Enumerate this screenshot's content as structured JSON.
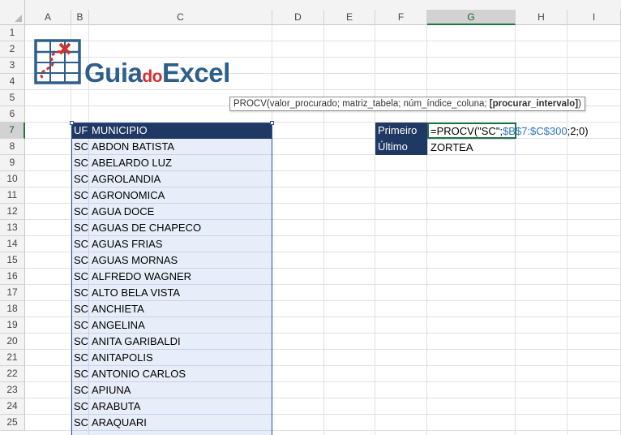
{
  "columns": [
    "A",
    "B",
    "C",
    "D",
    "E",
    "F",
    "G",
    "H",
    "I"
  ],
  "rows": [
    "1",
    "2",
    "3",
    "4",
    "5",
    "6",
    "7",
    "8",
    "9",
    "10",
    "11",
    "12",
    "13",
    "14",
    "15",
    "16",
    "17",
    "18",
    "19",
    "20",
    "21",
    "22",
    "23",
    "24",
    "25"
  ],
  "active_column": "G",
  "active_row": "7",
  "logo": {
    "part1": "Guia",
    "part2": "do",
    "part3": "Excel",
    "icon": "grid-with-red-x-logo-icon"
  },
  "tooltip": {
    "func": "PROCV(",
    "args": "valor_procurado; matriz_tabela; núm_índice_coluna; ",
    "opt": "[procurar_intervalo]",
    "close": ")"
  },
  "table": {
    "header": [
      "UF",
      "MUNICIPIO"
    ],
    "rows": [
      [
        "SC",
        "ABDON BATISTA"
      ],
      [
        "SC",
        "ABELARDO LUZ"
      ],
      [
        "SC",
        "AGROLANDIA"
      ],
      [
        "SC",
        "AGRONOMICA"
      ],
      [
        "SC",
        "AGUA DOCE"
      ],
      [
        "SC",
        "AGUAS DE CHAPECO"
      ],
      [
        "SC",
        "AGUAS FRIAS"
      ],
      [
        "SC",
        "AGUAS MORNAS"
      ],
      [
        "SC",
        "ALFREDO WAGNER"
      ],
      [
        "SC",
        "ALTO BELA VISTA"
      ],
      [
        "SC",
        "ANCHIETA"
      ],
      [
        "SC",
        "ANGELINA"
      ],
      [
        "SC",
        "ANITA GARIBALDI"
      ],
      [
        "SC",
        "ANITAPOLIS"
      ],
      [
        "SC",
        "ANTONIO CARLOS"
      ],
      [
        "SC",
        "APIUNA"
      ],
      [
        "SC",
        "ARABUTA"
      ],
      [
        "SC",
        "ARAQUARI"
      ]
    ]
  },
  "lookup": {
    "label1": "Primeiro",
    "formula_start": "=PROCV(\"SC\";",
    "formula_range": "$B$7:$C$300",
    "formula_end": ";2;0)",
    "label2": "Último",
    "value2": "ZORTEA"
  },
  "colors": {
    "header": "#203864",
    "table_fill": "#e8eef9",
    "range_ref": "#2f75b5",
    "selection": "#217346",
    "logo_blue": "#2e5f8a",
    "logo_red": "#d3302f"
  }
}
